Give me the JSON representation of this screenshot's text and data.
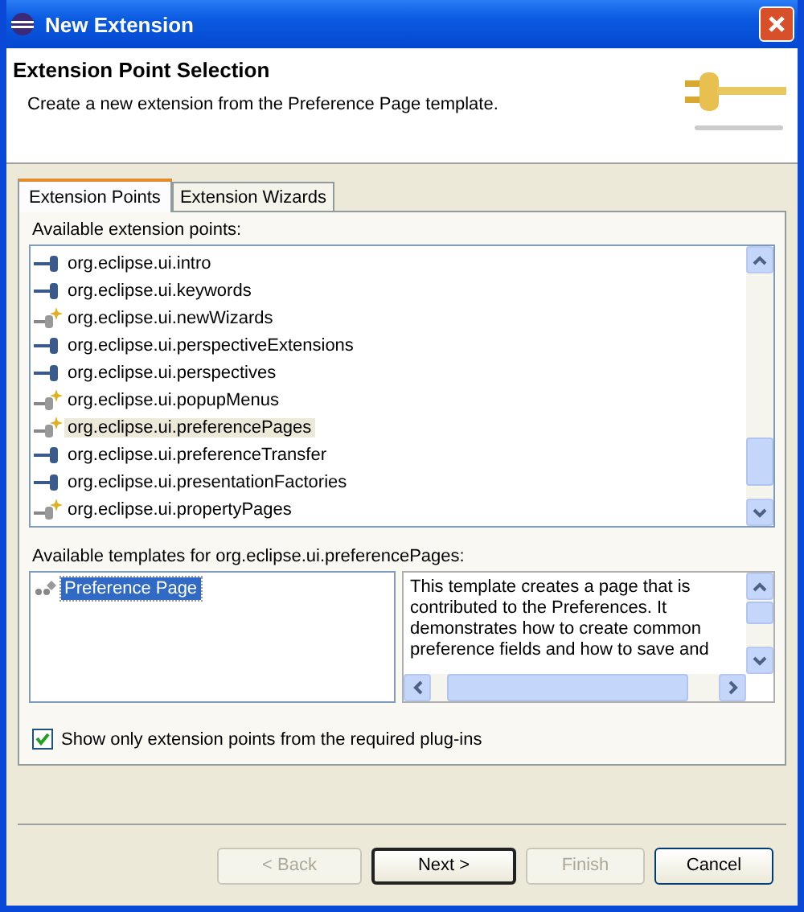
{
  "window": {
    "title": "New Extension"
  },
  "header": {
    "title": "Extension Point Selection",
    "description": "Create a new extension from the Preference Page template."
  },
  "tabs": [
    {
      "label": "Extension Points",
      "selected": true
    },
    {
      "label": "Extension Wizards",
      "selected": false
    }
  ],
  "extension_points": {
    "label": "Available extension points:",
    "items": [
      {
        "label": "org.eclipse.ui.intro",
        "kind": "plug",
        "selected": false
      },
      {
        "label": "org.eclipse.ui.keywords",
        "kind": "plug",
        "selected": false
      },
      {
        "label": "org.eclipse.ui.newWizards",
        "kind": "wizard",
        "selected": false
      },
      {
        "label": "org.eclipse.ui.perspectiveExtensions",
        "kind": "plug",
        "selected": false
      },
      {
        "label": "org.eclipse.ui.perspectives",
        "kind": "plug",
        "selected": false
      },
      {
        "label": "org.eclipse.ui.popupMenus",
        "kind": "wizard",
        "selected": false
      },
      {
        "label": "org.eclipse.ui.preferencePages",
        "kind": "wizard",
        "selected": true
      },
      {
        "label": "org.eclipse.ui.preferenceTransfer",
        "kind": "plug",
        "selected": false
      },
      {
        "label": "org.eclipse.ui.presentationFactories",
        "kind": "plug",
        "selected": false
      },
      {
        "label": "org.eclipse.ui.propertyPages",
        "kind": "wizard",
        "selected": false
      }
    ]
  },
  "templates": {
    "label": "Available templates for org.eclipse.ui.preferencePages:",
    "items": [
      {
        "label": "Preference Page",
        "selected": true
      }
    ],
    "description": "This template creates a page that is contributed to the Preferences. It demonstrates how to create common preference fields and how to save and"
  },
  "filter_checkbox": {
    "label": "Show only extension points from the required plug-ins",
    "checked": true
  },
  "buttons": [
    {
      "label": "< Back",
      "disabled": true,
      "default": false
    },
    {
      "label": "Next >",
      "disabled": false,
      "default": true
    },
    {
      "label": "Finish",
      "disabled": true,
      "default": false
    },
    {
      "label": "Cancel",
      "disabled": false,
      "default": false
    }
  ]
}
